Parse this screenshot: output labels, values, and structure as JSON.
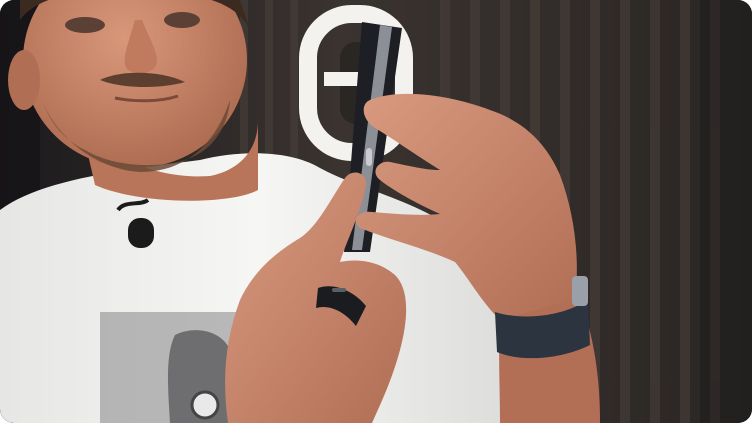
{
  "scene": {
    "kind": "video-frame",
    "subject": "man-holding-phone-edge-on",
    "colors": {
      "background_dark": "#2a2624",
      "wall_slat": "#3a3330",
      "wall_slat_light": "#4a413c",
      "neon_sign": "#f4f2ef",
      "shirt": "#f1f1ef",
      "skin": "#c9876a",
      "skin_shadow": "#a8664c",
      "beard": "#6b4a36",
      "phone": "#1d1f24",
      "phone_edge": "#8c8f96",
      "watch_band": "#2c3440",
      "ring": "#1a1c20",
      "shirt_print": "#8f8f91"
    }
  }
}
